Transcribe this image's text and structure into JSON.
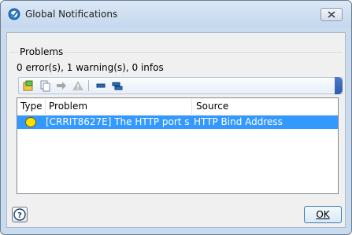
{
  "window": {
    "title": "Global Notifications",
    "close_label": "close"
  },
  "problems": {
    "group_label": "Problems",
    "summary": "0 error(s), 1 warning(s), 0 infos"
  },
  "toolbar": {
    "buttons": [
      "open-icon",
      "copy-icon",
      "forward-icon",
      "warning-filter-icon",
      "collapse-all-icon",
      "expand-all-icon"
    ]
  },
  "table": {
    "columns": [
      "Type",
      "Problem",
      "Source"
    ],
    "rows": [
      {
        "type_icon": "warning-circle-icon",
        "problem": "[CRRIT8627E] The HTTP port s...",
        "source": "HTTP Bind Address",
        "selected": true
      }
    ]
  },
  "footer": {
    "ok_label": "OK",
    "help_icon": "help-icon"
  },
  "colors": {
    "selection": "#3399ff",
    "toolbar_accent": "#2e5db0",
    "warning_icon": "#ffe300"
  }
}
